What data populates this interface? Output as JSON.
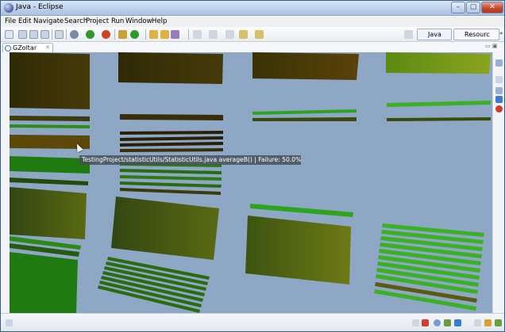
{
  "window": {
    "title": "Java - Eclipse"
  },
  "menu": [
    "File",
    "Edit",
    "Navigate",
    "Search",
    "Project",
    "Run",
    "Window",
    "Help"
  ],
  "perspective": {
    "java_label": "Java",
    "resource_label": "Resourc",
    "overflow": "»"
  },
  "view_tab": {
    "label": "GZoltar",
    "close": "✕"
  },
  "tooltip": {
    "text": "TestingProject/statisticUtils/StatisticUtils.java  averageB() | Failure: 50.0%"
  },
  "colors": {
    "canvas": "#8ea7c4",
    "dark_block": "#3b2f08",
    "green": "#2ea31c",
    "olive": "#5a5a10"
  },
  "icons": {
    "toolbar": [
      "new-icon",
      "save-icon",
      "print-icon",
      "debug-icon",
      "run-icon",
      "external-tools-icon",
      "new-java-project-icon",
      "new-class-icon",
      "open-type-icon",
      "search-icon",
      "next-annotation-icon",
      "back-icon",
      "forward-icon"
    ],
    "status": [
      "fast-view-icon",
      "task-icon",
      "problems-icon",
      "console-icon",
      "declaration-icon",
      "javadoc-icon",
      "progress-icon"
    ]
  }
}
